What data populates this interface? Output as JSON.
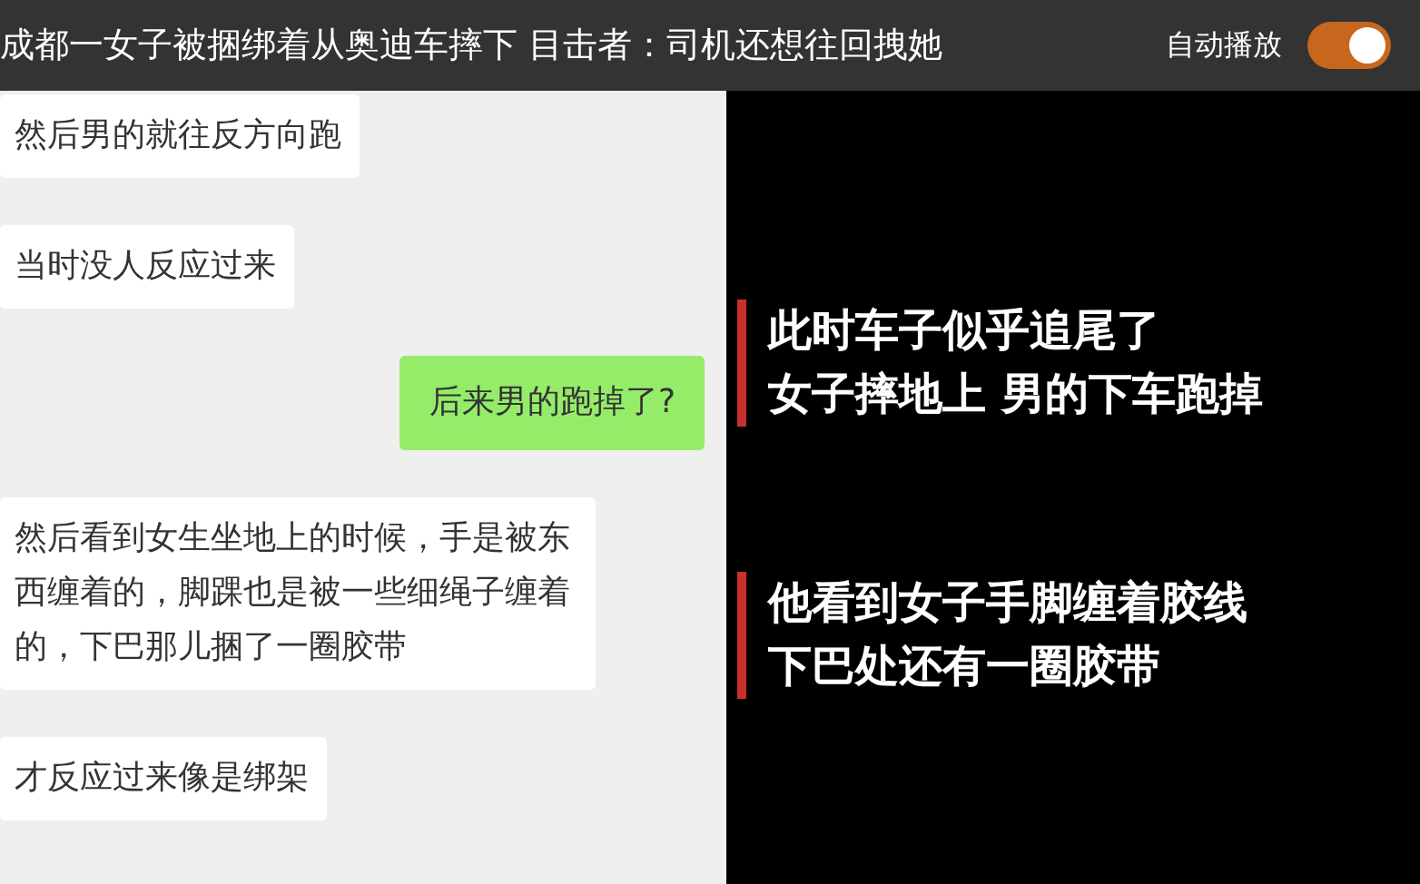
{
  "header": {
    "title": "成都一女子被捆绑着从奥迪车摔下 目击者：司机还想往回拽她",
    "autoplay": {
      "label": "自动播放",
      "on": true
    }
  },
  "chat": [
    {
      "kind": "received",
      "text": "然后男的就往反方向跑"
    },
    {
      "kind": "received",
      "text": "当时没人反应过来"
    },
    {
      "kind": "sent",
      "text": "后来男的跑掉了?"
    },
    {
      "kind": "received",
      "text": "然后看到女生坐地上的时候，手是被东西缠着的，脚踝也是被一些细绳子缠着的，下巴那儿捆了一圈胶带"
    },
    {
      "kind": "received",
      "text": "才反应过来像是绑架"
    }
  ],
  "captions": [
    {
      "lines": [
        "此时车子似乎追尾了",
        "女子摔地上 男的下车跑掉"
      ]
    },
    {
      "lines": [
        "他看到女子手脚缠着胶线",
        "下巴处还有一圈胶带"
      ]
    }
  ]
}
